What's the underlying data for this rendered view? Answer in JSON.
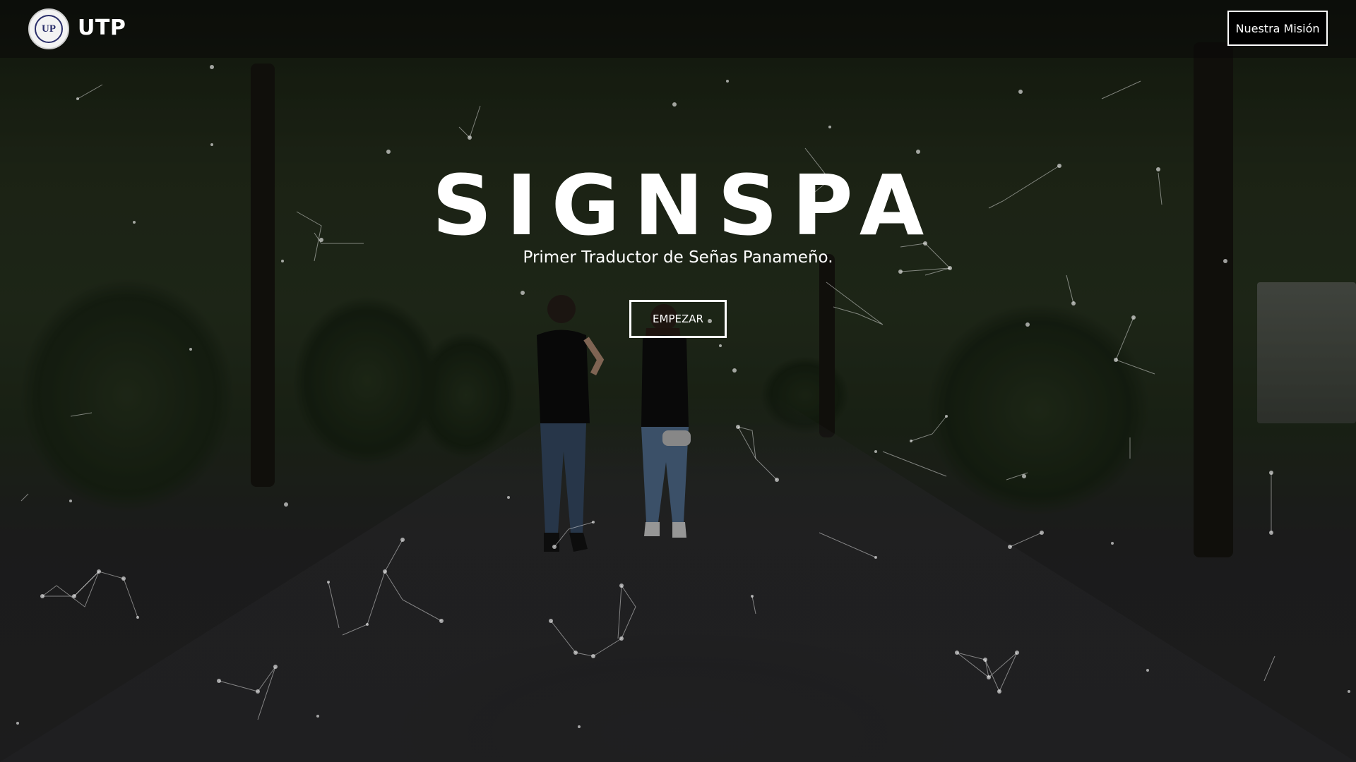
{
  "navbar": {
    "logo_icon": "utp-seal-logo",
    "brand": "UTP",
    "mission_button": "Nuestra Misión"
  },
  "hero": {
    "title": "SIGNSPA",
    "subtitle": "Primer Traductor de Señas Panameño.",
    "start_button": "EMPEZAR",
    "background": "park-path-two-people-signing-photo"
  },
  "colors": {
    "text": "#ffffff",
    "navbar_bg": "#0a0a0a",
    "button_border": "#ffffff"
  }
}
